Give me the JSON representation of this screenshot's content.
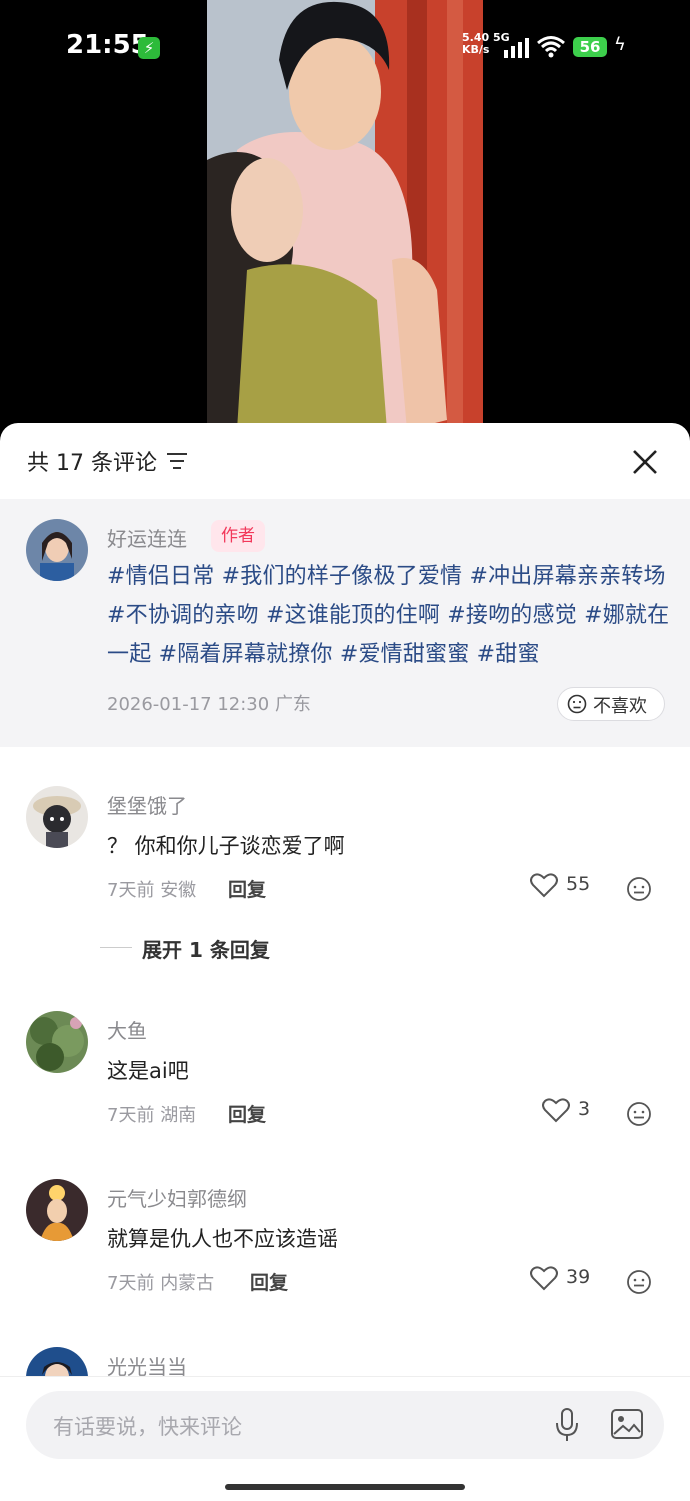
{
  "status_bar": {
    "time": "21:55",
    "net_speed": "5.40",
    "net_unit": "KB/s",
    "net_type": "5G",
    "battery": "56"
  },
  "comments_panel": {
    "count_label": "共 17 条评论",
    "author_comment": {
      "username": "好运连连",
      "badge": "作者",
      "text": "#情侣日常 #我们的样子像极了爱情 #冲出屏幕亲亲转场 #不协调的亲吻 #这谁能顶的住啊 #接吻的感觉 #娜就在一起 #隔着屏幕就撩你 #爱情甜蜜蜜 #甜蜜",
      "timestamp": "2026-01-17 12:30",
      "location": "广东",
      "dislike_label": "不喜欢"
    },
    "comments": [
      {
        "username": "堡堡饿了",
        "text": "？ 你和你儿子谈恋爱了啊",
        "time": "7天前",
        "location": "安徽",
        "reply_label": "回复",
        "likes": "55"
      },
      {
        "username": "大鱼",
        "text": "这是ai吧",
        "time": "7天前",
        "location": "湖南",
        "reply_label": "回复",
        "likes": "3"
      },
      {
        "username": "元气少妇郭德纲",
        "text": "就算是仇人也不应该造谣",
        "time": "7天前",
        "location": "内蒙古",
        "reply_label": "回复",
        "likes": "39"
      },
      {
        "username": "光光当当"
      }
    ],
    "expand_replies_label": "展开 1 条回复"
  },
  "input": {
    "placeholder": "有话要说，快来评论"
  },
  "icons": {
    "filter": "filter-icon",
    "close": "close-icon",
    "heart": "heart-icon",
    "emoji": "emoji-icon",
    "mic": "microphone-icon",
    "image": "image-icon"
  },
  "colors": {
    "hashtag": "#2b4b86",
    "author_badge_bg": "#ffe6ec",
    "author_badge_text": "#f2385a",
    "battery": "#3dcf4c"
  }
}
